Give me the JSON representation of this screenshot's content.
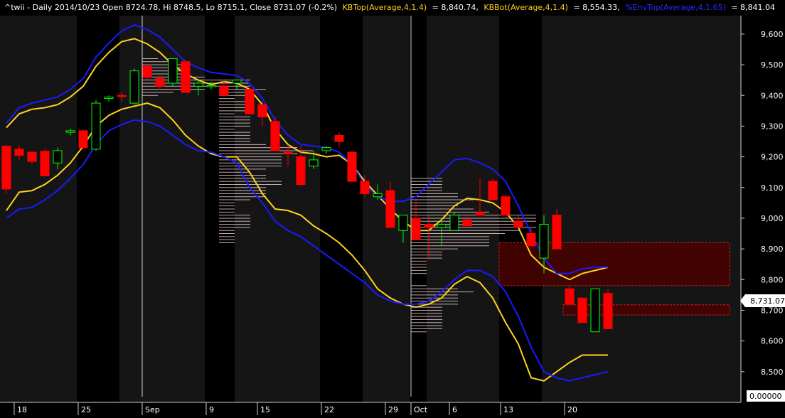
{
  "header": {
    "symbol_info": "^twii - Daily 2014/10/23 Open 8724.78, Hi 8748.5, Lo 8715.1, Close 8731.07 (-0.2%)",
    "kbtop_label": "KBTop(Average,4,1.4)",
    "kbtop_value": "= 8,840.74,",
    "kbbot_label": "KBBot(Average,4,1.4)",
    "kbbot_value": "= 8,554.33,",
    "envtop_label": "%EnvTop(Average,4,1.65)",
    "envtop_value": "= 8,841.04"
  },
  "price_tag": "8,731.07",
  "indicator_value": "0.00000",
  "colors": {
    "background": "#000000",
    "alt_band": "#151515",
    "up_candle": "#00ff00",
    "down_candle": "#ff0000",
    "keltner_band": "#ffd21e",
    "envelope_band": "#1a1aff",
    "volume_profile": "#f4d4d4",
    "zone_fill": "#4a0000",
    "zone_border": "#cc2222",
    "header_yellow": "#ffd21e",
    "header_blue": "#2a2aff"
  },
  "chart_data": {
    "type": "candlestick",
    "ylim": [
      8400,
      9660
    ],
    "y_ticks": [
      8500,
      8600,
      8700,
      8800,
      8900,
      9000,
      9100,
      9200,
      9300,
      9400,
      9500,
      9600
    ],
    "y_tick_labels": [
      "8,500",
      "8,600",
      "8,700",
      "8,800",
      "8,900",
      "9,000",
      "9,100",
      "9,200",
      "9,300",
      "9,400",
      "9,500",
      "9,600"
    ],
    "dates": [
      "2014-08-15",
      "2014-08-18",
      "2014-08-19",
      "2014-08-20",
      "2014-08-21",
      "2014-08-22",
      "2014-08-25",
      "2014-08-26",
      "2014-08-27",
      "2014-08-28",
      "2014-08-29",
      "2014-09-01",
      "2014-09-02",
      "2014-09-03",
      "2014-09-04",
      "2014-09-05",
      "2014-09-09",
      "2014-09-10",
      "2014-09-11",
      "2014-09-12",
      "2014-09-15",
      "2014-09-16",
      "2014-09-17",
      "2014-09-18",
      "2014-09-19",
      "2014-09-22",
      "2014-09-23",
      "2014-09-24",
      "2014-09-25",
      "2014-09-26",
      "2014-09-29",
      "2014-09-30",
      "2014-10-01",
      "2014-10-02",
      "2014-10-03",
      "2014-10-06",
      "2014-10-07",
      "2014-10-08",
      "2014-10-09",
      "2014-10-13",
      "2014-10-14",
      "2014-10-15",
      "2014-10-16",
      "2014-10-17",
      "2014-10-20",
      "2014-10-21",
      "2014-10-22",
      "2014-10-23"
    ],
    "x_tick_labels": [
      {
        "label": "18",
        "date_index": 1
      },
      {
        "label": "25",
        "date_index": 6
      },
      {
        "label": "Sep",
        "date_index": 11
      },
      {
        "label": "9",
        "date_index": 16
      },
      {
        "label": "15",
        "date_index": 20
      },
      {
        "label": "22",
        "date_index": 25
      },
      {
        "label": "29",
        "date_index": 30
      },
      {
        "label": "Oct",
        "date_index": 32
      },
      {
        "label": "6",
        "date_index": 35
      },
      {
        "label": "13",
        "date_index": 39
      },
      {
        "label": "20",
        "date_index": 44
      }
    ],
    "month_separators": [
      11,
      32
    ],
    "ohlc": [
      [
        9235,
        9240,
        9080,
        9095
      ],
      [
        9225,
        9238,
        9190,
        9205
      ],
      [
        9215,
        9220,
        9180,
        9185
      ],
      [
        9218,
        9225,
        9140,
        9138
      ],
      [
        9180,
        9230,
        9160,
        9220
      ],
      [
        9280,
        9292,
        9270,
        9285
      ],
      [
        9285,
        9290,
        9225,
        9230
      ],
      [
        9225,
        9385,
        9220,
        9375
      ],
      [
        9390,
        9400,
        9380,
        9395
      ],
      [
        9400,
        9410,
        9380,
        9398
      ],
      [
        9375,
        9488,
        9370,
        9480
      ],
      [
        9495,
        9500,
        9450,
        9460
      ],
      [
        9455,
        9465,
        9420,
        9430
      ],
      [
        9440,
        9520,
        9430,
        9520
      ],
      [
        9510,
        9515,
        9410,
        9410
      ],
      [
        9430,
        9450,
        9400,
        9440
      ],
      [
        9430,
        9445,
        9420,
        9432
      ],
      [
        9430,
        9450,
        9395,
        9400
      ],
      [
        9440,
        9450,
        9420,
        9450
      ],
      [
        9420,
        9422,
        9350,
        9340
      ],
      [
        9370,
        9380,
        9300,
        9330
      ],
      [
        9315,
        9330,
        9220,
        9220
      ],
      [
        9215,
        9240,
        9170,
        9210
      ],
      [
        9200,
        9235,
        9105,
        9110
      ],
      [
        9170,
        9220,
        9160,
        9190
      ],
      [
        9220,
        9235,
        9210,
        9230
      ],
      [
        9270,
        9280,
        9230,
        9250
      ],
      [
        9215,
        9220,
        9120,
        9120
      ],
      [
        9120,
        9140,
        9070,
        9080
      ],
      [
        9070,
        9110,
        9060,
        9080
      ],
      [
        9090,
        9120,
        8970,
        8970
      ],
      [
        8960,
        9010,
        8920,
        9010
      ],
      [
        9000,
        9060,
        8950,
        8930
      ],
      [
        8980,
        9010,
        8870,
        8970
      ],
      [
        8970,
        9000,
        8910,
        8980
      ],
      [
        8960,
        9020,
        8960,
        9010
      ],
      [
        8995,
        9005,
        8990,
        8975
      ],
      [
        9020,
        9130,
        9010,
        9010
      ],
      [
        9120,
        9130,
        9060,
        9060
      ],
      [
        9070,
        9080,
        9010,
        9010
      ],
      [
        8990,
        9010,
        8970,
        8970
      ],
      [
        8950,
        8970,
        8910,
        8910
      ],
      [
        8870,
        9010,
        8820,
        8980
      ],
      [
        9010,
        9030,
        8900,
        8900
      ],
      [
        8770,
        8780,
        8720,
        8720
      ],
      [
        8740,
        8760,
        8760,
        8660
      ],
      [
        8630,
        8770,
        8630,
        8770
      ],
      [
        8755,
        8770,
        8640,
        8640
      ]
    ],
    "series": [
      {
        "name": "KBTop(Average,4,1.4)",
        "type": "line",
        "values": [
          9295,
          9340,
          9355,
          9360,
          9370,
          9395,
          9430,
          9495,
          9540,
          9575,
          9585,
          9568,
          9540,
          9500,
          9470,
          9450,
          9435,
          9445,
          9440,
          9420,
          9370,
          9290,
          9240,
          9215,
          9210,
          9200,
          9205,
          9175,
          9120,
          9075,
          9030,
          8990,
          8960,
          8960,
          8995,
          9040,
          9065,
          9060,
          9050,
          9020,
          8970,
          8880,
          8840,
          8820,
          8800,
          8820,
          8830,
          8840
        ]
      },
      {
        "name": "KBBot(Average,4,1.4)",
        "type": "line",
        "values": [
          9025,
          9085,
          9090,
          9110,
          9140,
          9180,
          9235,
          9300,
          9335,
          9355,
          9365,
          9375,
          9360,
          9320,
          9270,
          9235,
          9210,
          9200,
          9200,
          9150,
          9080,
          9030,
          9025,
          9010,
          8975,
          8950,
          8920,
          8880,
          8830,
          8770,
          8740,
          8720,
          8710,
          8720,
          8740,
          8785,
          8810,
          8790,
          8740,
          8660,
          8590,
          8480,
          8470,
          8500,
          8530,
          8554,
          8554,
          8554
        ]
      },
      {
        "name": "%EnvTop(Average,4,1.65)",
        "type": "line",
        "values": [
          9310,
          9360,
          9375,
          9385,
          9395,
          9420,
          9455,
          9525,
          9570,
          9610,
          9630,
          9615,
          9590,
          9550,
          9510,
          9490,
          9475,
          9470,
          9465,
          9440,
          9390,
          9320,
          9270,
          9240,
          9235,
          9230,
          9215,
          9175,
          9110,
          9070,
          9055,
          9055,
          9070,
          9110,
          9150,
          9190,
          9195,
          9180,
          9160,
          9120,
          9040,
          8950,
          8870,
          8820,
          8820,
          8835,
          8840,
          8841
        ]
      },
      {
        "name": "",
        "type": "line",
        "values": [
          9000,
          9030,
          9035,
          9060,
          9090,
          9130,
          9175,
          9240,
          9285,
          9305,
          9320,
          9315,
          9300,
          9270,
          9240,
          9220,
          9215,
          9200,
          9180,
          9100,
          9050,
          8990,
          8960,
          8940,
          8910,
          8880,
          8850,
          8820,
          8790,
          8750,
          8730,
          8720,
          8720,
          8730,
          8760,
          8800,
          8830,
          8830,
          8810,
          8760,
          8680,
          8580,
          8500,
          8480,
          8470,
          8480,
          8490,
          8500
        ]
      }
    ],
    "zones": [
      {
        "y_top": 8920,
        "y_bottom": 8780,
        "x_start_index": 39,
        "x_end_index": 47
      },
      {
        "y_top": 8718,
        "y_bottom": 8685,
        "x_start_index": 44,
        "x_end_index": 47
      }
    ]
  }
}
